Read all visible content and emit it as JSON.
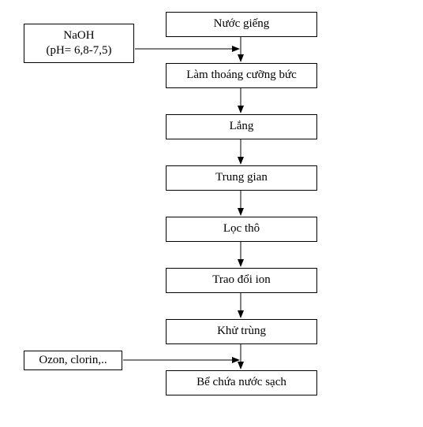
{
  "chart_data": {
    "type": "flowchart",
    "title": "",
    "nodes": [
      {
        "id": "n1",
        "label": "Nước giếng"
      },
      {
        "id": "n2",
        "label": "Làm thoáng cưỡng bức"
      },
      {
        "id": "n3",
        "label": "Lắng"
      },
      {
        "id": "n4",
        "label": "Trung gian"
      },
      {
        "id": "n5",
        "label": "Lọc thô"
      },
      {
        "id": "n6",
        "label": "Trao đổi ion"
      },
      {
        "id": "n7",
        "label": "Khử trùng"
      },
      {
        "id": "n8",
        "label": "Bể chứa nước sạch"
      },
      {
        "id": "s1",
        "label_line1": "NaOH",
        "label_line2": "(pH= 6,8-7,5)"
      },
      {
        "id": "s2",
        "label": "Ozon, clorin,.."
      }
    ],
    "edges": [
      {
        "from": "n1",
        "to": "n2"
      },
      {
        "from": "n2",
        "to": "n3"
      },
      {
        "from": "n3",
        "to": "n4"
      },
      {
        "from": "n4",
        "to": "n5"
      },
      {
        "from": "n5",
        "to": "n6"
      },
      {
        "from": "n6",
        "to": "n7"
      },
      {
        "from": "n7",
        "to": "n8"
      },
      {
        "from": "s1",
        "to": "edge_n1_n2"
      },
      {
        "from": "s2",
        "to": "edge_n7_n8"
      }
    ]
  }
}
